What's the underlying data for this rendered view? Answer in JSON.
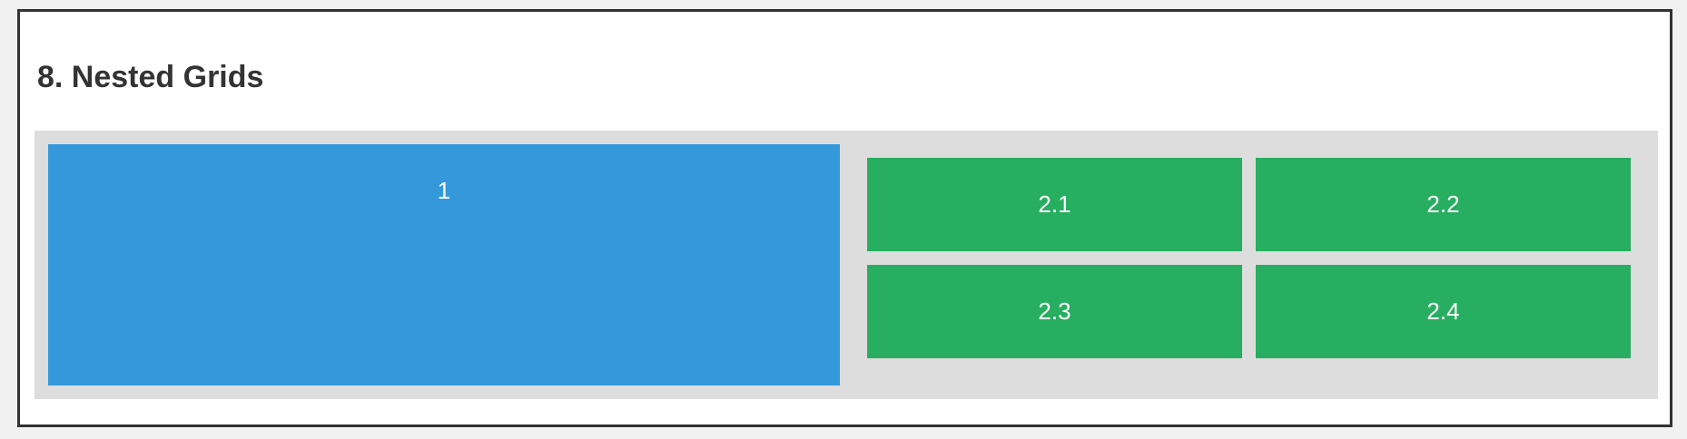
{
  "section": {
    "title": "8. Nested Grids"
  },
  "outer_grid": {
    "item_1": "1",
    "nested": {
      "items": [
        "2.1",
        "2.2",
        "2.3",
        "2.4"
      ]
    }
  },
  "colors": {
    "frame_border": "#333333",
    "grid_background": "#dddddd",
    "item_blue": "#3598db",
    "item_green": "#27ae60"
  }
}
